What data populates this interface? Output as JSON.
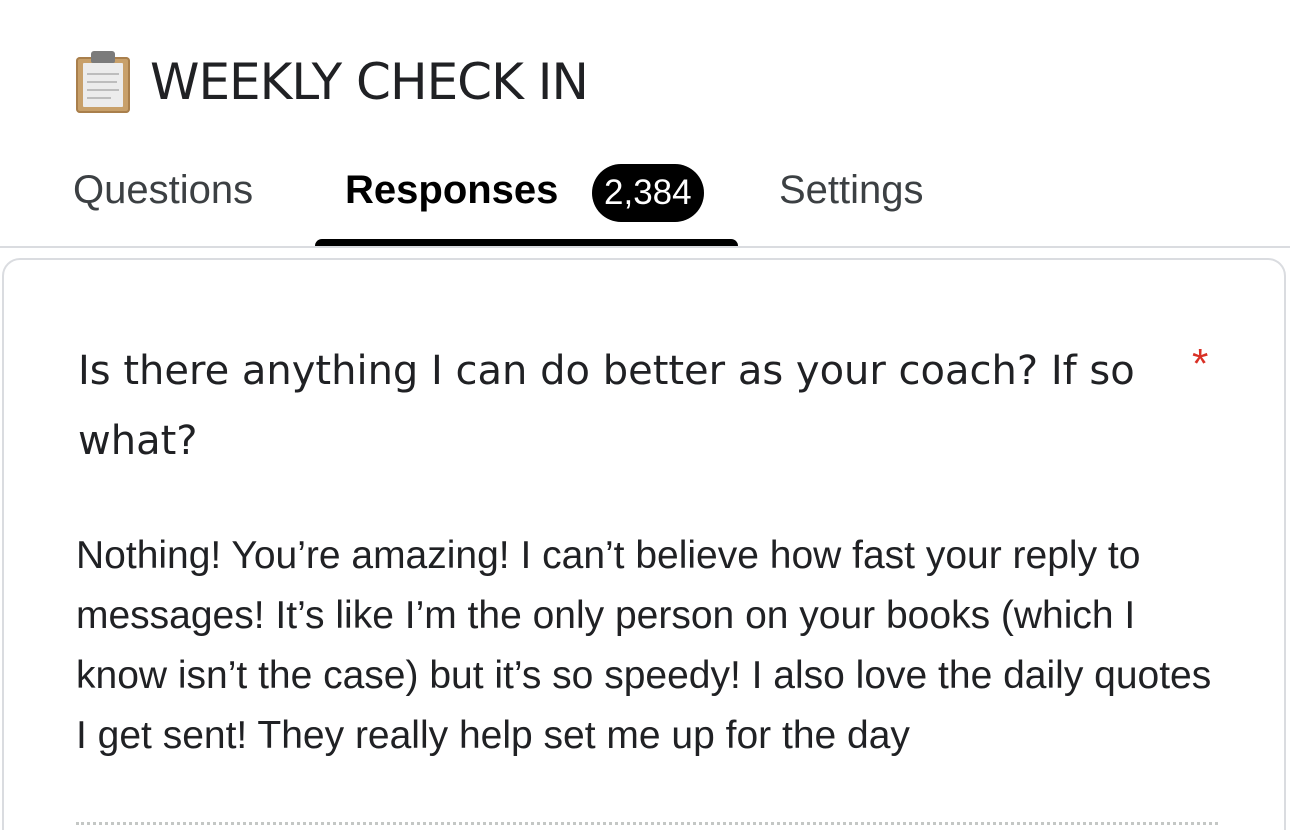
{
  "form": {
    "icon": "clipboard-icon",
    "title": "WEEKLY CHECK IN"
  },
  "tabs": {
    "questions_label": "Questions",
    "responses_label": "Responses",
    "responses_count": "2,384",
    "settings_label": "Settings",
    "active": "Responses"
  },
  "question": {
    "title": "Is there anything I can do better as your coach? If so what?",
    "required_marker": "*",
    "answer": "Nothing! You’re amazing! I can’t believe how fast your reply to messages! It’s like I’m the only person on your books (which I know isn’t the case) but it’s so speedy! I also love the daily quotes I get sent! They really help set me up for the day"
  },
  "colors": {
    "required": "#d93025",
    "active_tab": "#000000",
    "badge_bg": "#000000",
    "divider": "#dadce0"
  }
}
